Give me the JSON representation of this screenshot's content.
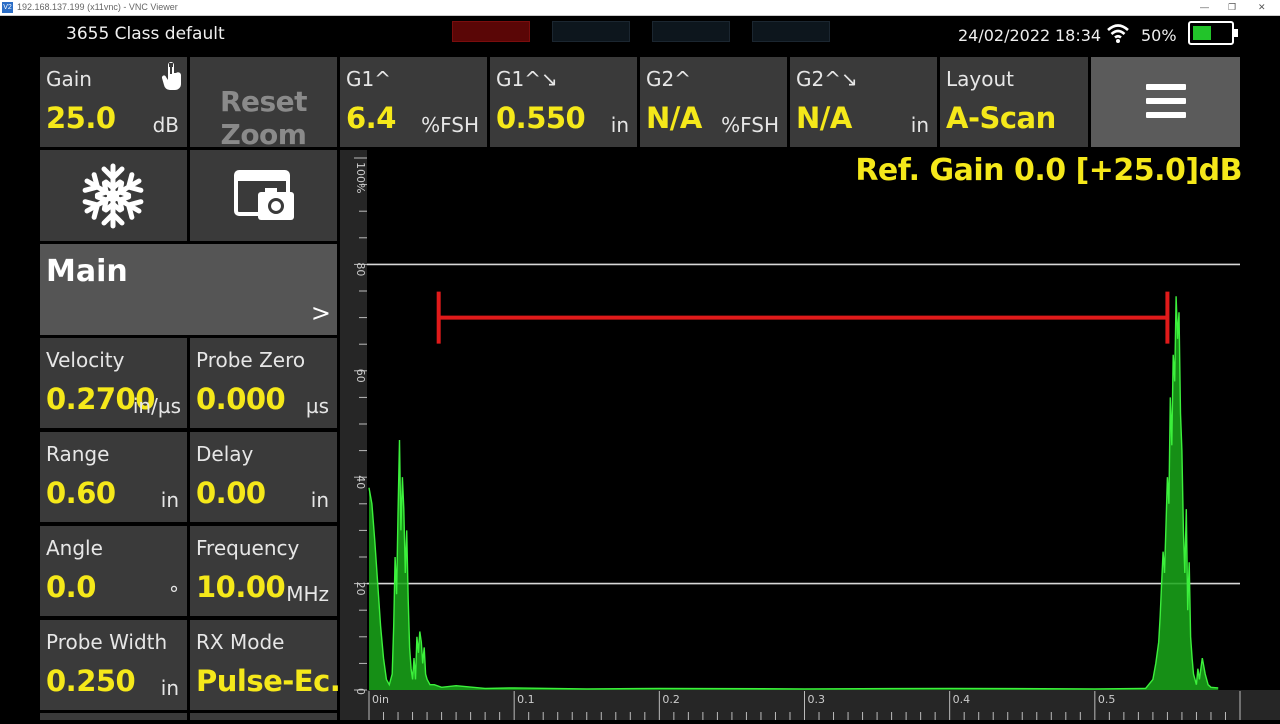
{
  "vnc": {
    "title": "192.168.137.199 (x11vnc) - VNC Viewer",
    "icon_text": "V2",
    "controls": [
      "minimize-icon",
      "restore-icon",
      "close-icon"
    ]
  },
  "status": {
    "profile": "3655 Class default",
    "date": "24/02/2022",
    "time": "18:34",
    "battery_percent": "50%",
    "battery_level": 0.5,
    "wifi_icon": "wifi-icon"
  },
  "top_tiles": {
    "gain": {
      "label": "Gain",
      "value": "25.0",
      "unit": "dB",
      "icon": "touch-hand-icon"
    },
    "reset_zoom": {
      "label": "Reset Zoom"
    },
    "g1_peak": {
      "label": "G1^",
      "value": "6.4",
      "unit": "%FSH"
    },
    "g1_depth": {
      "label": "G1^↘",
      "value": "0.550",
      "unit": "in"
    },
    "g2_peak": {
      "label": "G2^",
      "value": "N/A",
      "unit": "%FSH"
    },
    "g2_depth": {
      "label": "G2^↘",
      "value": "N/A",
      "unit": "in"
    },
    "layout": {
      "label": "Layout",
      "value": "A-Scan"
    },
    "menu": {
      "icon": "hamburger-menu-icon"
    }
  },
  "tools": {
    "freeze_icon": "snowflake-icon",
    "screenshot_icon": "screenshot-camera-icon"
  },
  "main": {
    "label": "Main",
    "arrow": ">"
  },
  "params": {
    "velocity": {
      "label": "Velocity",
      "value": "0.2700",
      "unit": "in/µs"
    },
    "probe_zero": {
      "label": "Probe Zero",
      "value": "0.000",
      "unit": "µs"
    },
    "range": {
      "label": "Range",
      "value": "0.60",
      "unit": "in"
    },
    "delay": {
      "label": "Delay",
      "value": "0.00",
      "unit": "in"
    },
    "angle": {
      "label": "Angle",
      "value": "0.0",
      "unit": "°"
    },
    "frequency": {
      "label": "Frequency",
      "value": "10.00",
      "unit": "MHz"
    },
    "probe_width": {
      "label": "Probe Width",
      "value": "0.250",
      "unit": "in"
    },
    "rx_mode": {
      "label": "RX Mode",
      "value": "Pulse-Ec..."
    }
  },
  "ref_gain": "Ref. Gain 0.0 [+25.0]dB",
  "colors": {
    "accent_yellow": "#f5e81a",
    "tile_bg": "#3a3a3a",
    "signal_green": "#2ee62e",
    "gate_red": "#e01a1a",
    "grid_line": "#d8d8d8"
  },
  "chart_data": {
    "type": "line",
    "x_unit": "in",
    "xlim": [
      0,
      0.6
    ],
    "ylim": [
      0,
      100
    ],
    "y_ticks": [
      {
        "v": 100,
        "label": "100%"
      },
      {
        "v": 80,
        "label": "80"
      },
      {
        "v": 60,
        "label": "60"
      },
      {
        "v": 40,
        "label": "40"
      },
      {
        "v": 20,
        "label": "20"
      },
      {
        "v": 0,
        "label": "0"
      }
    ],
    "x_ticks": [
      {
        "v": 0,
        "label": "0in"
      },
      {
        "v": 0.1,
        "label": "0.1"
      },
      {
        "v": 0.2,
        "label": "0.2"
      },
      {
        "v": 0.3,
        "label": "0.3"
      },
      {
        "v": 0.4,
        "label": "0.4"
      },
      {
        "v": 0.5,
        "label": "0.5"
      }
    ],
    "reference_lines_y": [
      80,
      20
    ],
    "gate": {
      "start": 0.048,
      "end": 0.55,
      "level": 70
    },
    "waveform": [
      [
        0.0,
        38
      ],
      [
        0.002,
        35
      ],
      [
        0.004,
        28
      ],
      [
        0.006,
        20
      ],
      [
        0.008,
        12
      ],
      [
        0.01,
        6
      ],
      [
        0.012,
        2
      ],
      [
        0.014,
        1
      ],
      [
        0.016,
        3
      ],
      [
        0.017,
        12
      ],
      [
        0.018,
        25
      ],
      [
        0.019,
        18
      ],
      [
        0.02,
        33
      ],
      [
        0.021,
        47
      ],
      [
        0.022,
        30
      ],
      [
        0.023,
        40
      ],
      [
        0.024,
        34
      ],
      [
        0.025,
        22
      ],
      [
        0.026,
        30
      ],
      [
        0.027,
        17
      ],
      [
        0.028,
        8
      ],
      [
        0.029,
        4
      ],
      [
        0.03,
        2
      ],
      [
        0.031,
        6
      ],
      [
        0.032,
        2
      ],
      [
        0.033,
        10
      ],
      [
        0.034,
        7
      ],
      [
        0.035,
        11
      ],
      [
        0.036,
        9
      ],
      [
        0.037,
        5
      ],
      [
        0.038,
        8
      ],
      [
        0.039,
        3
      ],
      [
        0.04,
        2
      ],
      [
        0.042,
        1
      ],
      [
        0.045,
        1
      ],
      [
        0.05,
        0.5
      ],
      [
        0.06,
        0.8
      ],
      [
        0.08,
        0.3
      ],
      [
        0.1,
        0.4
      ],
      [
        0.15,
        0.2
      ],
      [
        0.2,
        0.3
      ],
      [
        0.3,
        0.2
      ],
      [
        0.4,
        0.3
      ],
      [
        0.5,
        0.2
      ],
      [
        0.535,
        0.3
      ],
      [
        0.54,
        2
      ],
      [
        0.542,
        5
      ],
      [
        0.544,
        9
      ],
      [
        0.545,
        14
      ],
      [
        0.546,
        20
      ],
      [
        0.547,
        26
      ],
      [
        0.548,
        22
      ],
      [
        0.549,
        31
      ],
      [
        0.55,
        40
      ],
      [
        0.551,
        35
      ],
      [
        0.552,
        55
      ],
      [
        0.553,
        46
      ],
      [
        0.554,
        63
      ],
      [
        0.555,
        58
      ],
      [
        0.556,
        74
      ],
      [
        0.557,
        66
      ],
      [
        0.558,
        71
      ],
      [
        0.559,
        52
      ],
      [
        0.56,
        45
      ],
      [
        0.561,
        30
      ],
      [
        0.562,
        22
      ],
      [
        0.563,
        34
      ],
      [
        0.564,
        15
      ],
      [
        0.565,
        24
      ],
      [
        0.566,
        10
      ],
      [
        0.567,
        6
      ],
      [
        0.568,
        3
      ],
      [
        0.569,
        2
      ],
      [
        0.57,
        1
      ],
      [
        0.571,
        4
      ],
      [
        0.572,
        2
      ],
      [
        0.574,
        6
      ],
      [
        0.576,
        3
      ],
      [
        0.578,
        1
      ],
      [
        0.58,
        0.5
      ],
      [
        0.585,
        0.4
      ]
    ]
  }
}
